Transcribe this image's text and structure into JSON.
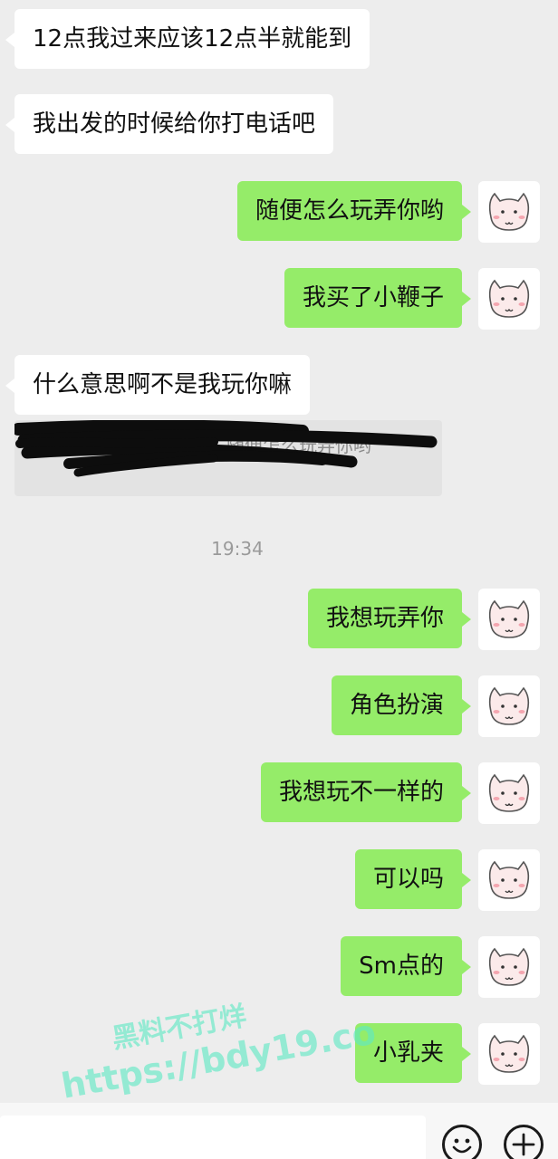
{
  "messages": [
    {
      "side": "in",
      "text": "12点我过来应该12点半就能到"
    },
    {
      "side": "in",
      "text": "我出发的时候给你打电话吧"
    },
    {
      "side": "out",
      "text": "随便怎么玩弄你哟"
    },
    {
      "side": "out",
      "text": "我买了小鞭子"
    },
    {
      "side": "in",
      "text": "什么意思啊不是我玩你嘛"
    },
    {
      "side": "out",
      "text": "我想玩弄你"
    },
    {
      "side": "out",
      "text": "角色扮演"
    },
    {
      "side": "out",
      "text": "我想玩不一样的"
    },
    {
      "side": "out",
      "text": "可以吗"
    },
    {
      "side": "out",
      "text": "Sm点的"
    },
    {
      "side": "out",
      "text": "小乳夹"
    }
  ],
  "quoted_reply": {
    "text": "：随便怎么玩弄你哟",
    "redacted": true
  },
  "timestamp": "19:34",
  "watermark": {
    "line1": "黑料不打烊",
    "line2": "https://bdy19.co"
  },
  "input": {
    "emoji_icon": "smiley-icon",
    "more_icon": "plus-circle-icon"
  },
  "colors": {
    "background": "#ededed",
    "incoming_bubble": "#ffffff",
    "outgoing_bubble": "#95ec69",
    "timestamp": "#9a9a9a",
    "watermark": "#5ee8c4"
  },
  "avatar_icon": "cat-sticker-avatar-icon"
}
